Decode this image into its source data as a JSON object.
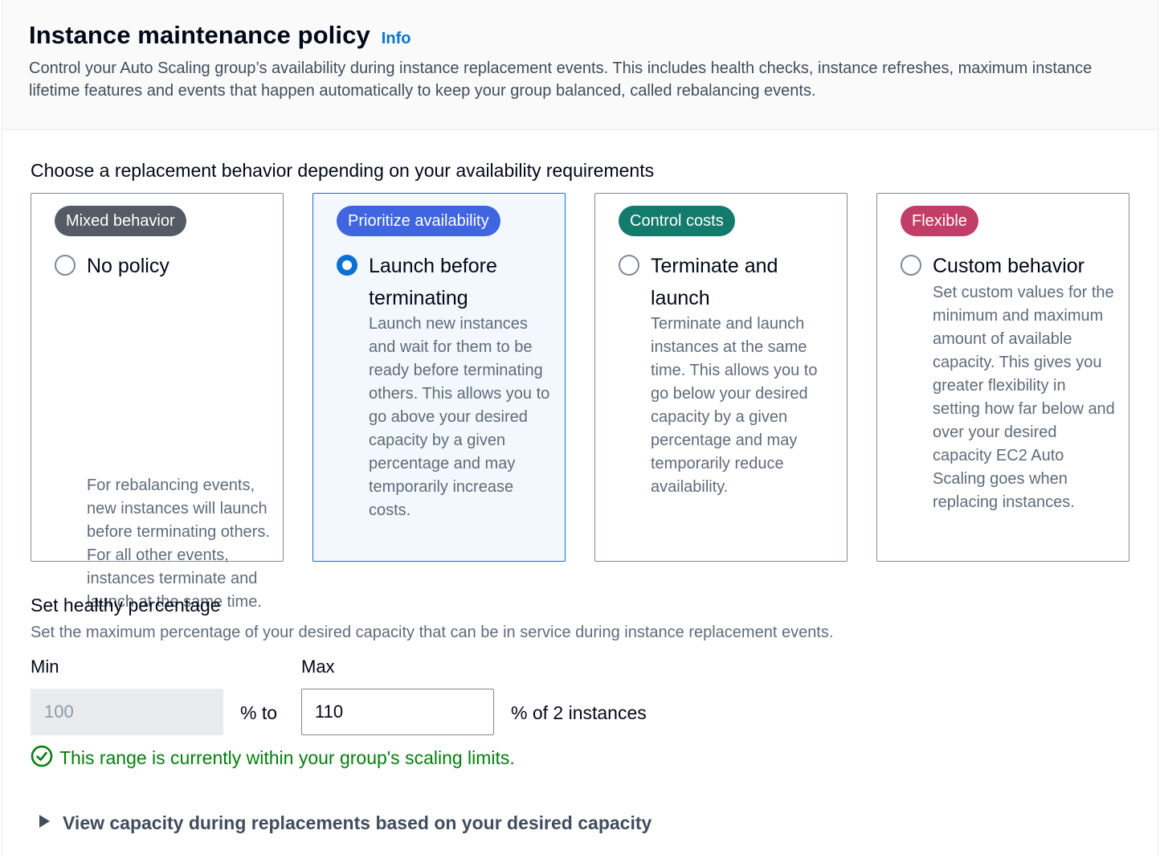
{
  "header": {
    "title": "Instance maintenance policy",
    "info_label": "Info",
    "description": "Control your Auto Scaling group’s availability during instance replacement events. This includes health checks, instance refreshes, maximum instance lifetime features and events that happen automatically to keep your group balanced, called rebalancing events."
  },
  "replacement": {
    "label": "Choose a replacement behavior depending on your availability requirements",
    "selected": "launch-before-terminating",
    "options": [
      {
        "badge": "Mixed behavior",
        "badge_color": "#545b64",
        "title": "No policy",
        "description": "For rebalancing events, new instances will launch before terminating others. For all other events, instances terminate and launch at the same time."
      },
      {
        "badge": "Prioritize availability",
        "badge_color": "#3f65e0",
        "title": "Launch before terminating",
        "description": "Launch new instances and wait for them to be ready before terminating others. This allows you to go above your desired capacity by a given percentage and may temporarily increase costs."
      },
      {
        "badge": "Control costs",
        "badge_color": "#137b6c",
        "title": "Terminate and launch",
        "description": "Terminate and launch instances at the same time. This allows you to go below your desired capacity by a given percentage and may temporarily reduce availability."
      },
      {
        "badge": "Flexible",
        "badge_color": "#c33d69",
        "title": "Custom behavior",
        "description": "Set custom values for the minimum and maximum amount of available capacity. This gives you greater flexibility in setting how far below and over your desired capacity EC2 Auto Scaling goes when replacing instances."
      }
    ]
  },
  "healthy_percentage": {
    "title": "Set healthy percentage",
    "description": "Set the maximum percentage of your desired capacity that can be in service during instance replacement events.",
    "min_label": "Min",
    "min_value": "100",
    "between_text": "% to",
    "max_label": "Max",
    "max_value": "110",
    "suffix_text": "% of 2 instances",
    "status_text": "This range is currently within your group's scaling limits.",
    "status_color": "#037f0c"
  },
  "expander": {
    "label": "View capacity during replacements based on your desired capacity"
  }
}
